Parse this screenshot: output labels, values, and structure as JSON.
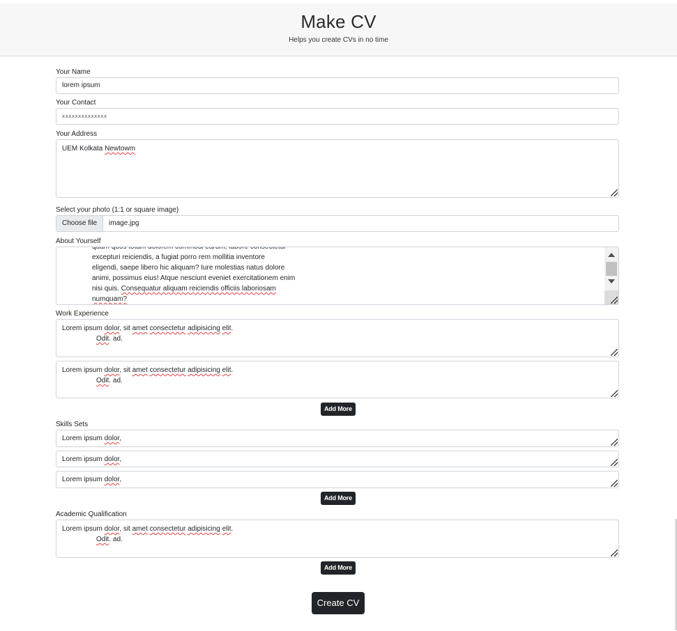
{
  "header": {
    "title": "Make CV",
    "subtitle": "Helps you create CVs in no time"
  },
  "name": {
    "label": "Your Name",
    "value": "lorem ipsum"
  },
  "contact": {
    "label": "Your Contact",
    "value": "xxxxxxxxxxxxxx"
  },
  "address": {
    "label": "Your Address",
    "value_a": "UEM Kolkata",
    "value_b": "Newtowm"
  },
  "photo": {
    "label": "Select your photo (1:1 or square image)",
    "button": "Choose file",
    "filename": "image.jpg"
  },
  "about": {
    "label": "About Yourself",
    "lines": [
      "quam quos totam dolorem commodi earum, labore consectetur",
      "excepturi reiciendis, a fugiat porro rem mollitia inventore",
      "eligendi, saepe libero hic aliquam? Iure molestias natus dolore",
      "animi, possimus eius! Atque nesciunt eveniet exercitationem enim",
      "nisi quis. Consequatur aliquam reiciendis officiis laboriosam",
      "numquam?"
    ]
  },
  "work": {
    "label": "Work Experience",
    "add_more": "Add More",
    "entries": [
      {
        "w": [
          "Lorem ipsum",
          "dolor",
          ", sit",
          "amet",
          "consectetur",
          "adipisicing",
          "elit",
          ".",
          "Odit",
          ". ad."
        ]
      },
      {
        "w": [
          "Lorem ipsum",
          "dolor",
          ", sit",
          "amet",
          "consectetur",
          "adipisicing",
          "elit",
          ".",
          "Odit",
          ". ad."
        ]
      }
    ]
  },
  "skills": {
    "label": "Skills Sets",
    "add_more": "Add More",
    "entries": [
      {
        "a": "Lorem ipsum",
        "b": "dolor",
        "c": ","
      },
      {
        "a": "Lorem ipsum",
        "b": "dolor",
        "c": ","
      },
      {
        "a": "Lorem ipsum",
        "b": "dolor",
        "c": ","
      }
    ]
  },
  "academic": {
    "label": "Academic Qualification",
    "add_more": "Add More",
    "entries": [
      {
        "w": [
          "Lorem ipsum",
          "dolor",
          ", sit",
          "amet",
          "consectetur",
          "adipisicing",
          "elit",
          ".",
          "Odit",
          ". ad."
        ]
      }
    ]
  },
  "submit_label": "Create CV"
}
